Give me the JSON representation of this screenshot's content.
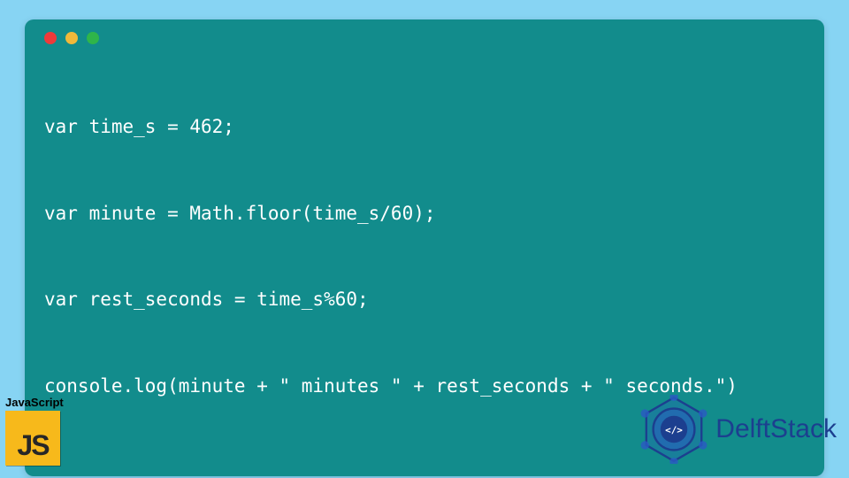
{
  "code": {
    "lines": [
      "var time_s = 462;",
      "var minute = Math.floor(time_s/60);",
      "var rest_seconds = time_s%60;",
      "console.log(minute + \" minutes \" + rest_seconds + \" seconds.\")"
    ]
  },
  "traffic_colors": {
    "red": "#ee3a3a",
    "yellow": "#f0b93a",
    "green": "#2fb54a"
  },
  "js_badge": {
    "label": "JavaScript",
    "tile_text": "JS"
  },
  "brand": {
    "name": "DelftStack"
  },
  "colors": {
    "page_bg": "#87d4f3",
    "card_bg": "#128c8c",
    "code_text": "#ffffff",
    "brand_text": "#1c3f8f"
  }
}
